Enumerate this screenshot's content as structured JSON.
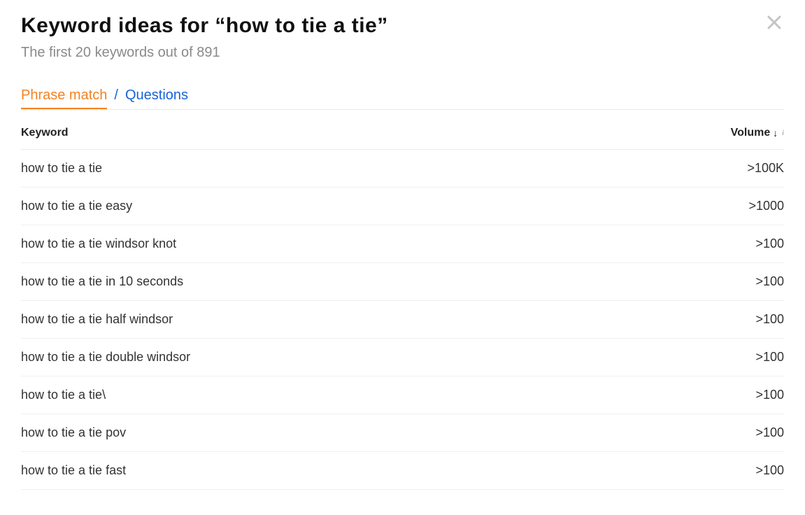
{
  "header": {
    "title_prefix": "Keyword ideas for ",
    "title_query": "“how to tie a tie”",
    "subtitle": "The first 20 keywords out of 891"
  },
  "tabs": {
    "active": "Phrase match",
    "separator": "/",
    "inactive": "Questions"
  },
  "table": {
    "columns": {
      "keyword": "Keyword",
      "volume": "Volume"
    },
    "rows": [
      {
        "keyword": "how to tie a tie",
        "volume": ">100K"
      },
      {
        "keyword": "how to tie a tie easy",
        "volume": ">1000"
      },
      {
        "keyword": "how to tie a tie windsor knot",
        "volume": ">100"
      },
      {
        "keyword": "how to tie a tie in 10 seconds",
        "volume": ">100"
      },
      {
        "keyword": "how to tie a tie half windsor",
        "volume": ">100"
      },
      {
        "keyword": "how to tie a tie double windsor",
        "volume": ">100"
      },
      {
        "keyword": "how to tie a tie\\",
        "volume": ">100"
      },
      {
        "keyword": "how to tie a tie pov",
        "volume": ">100"
      },
      {
        "keyword": "how to tie a tie fast",
        "volume": ">100"
      }
    ]
  }
}
